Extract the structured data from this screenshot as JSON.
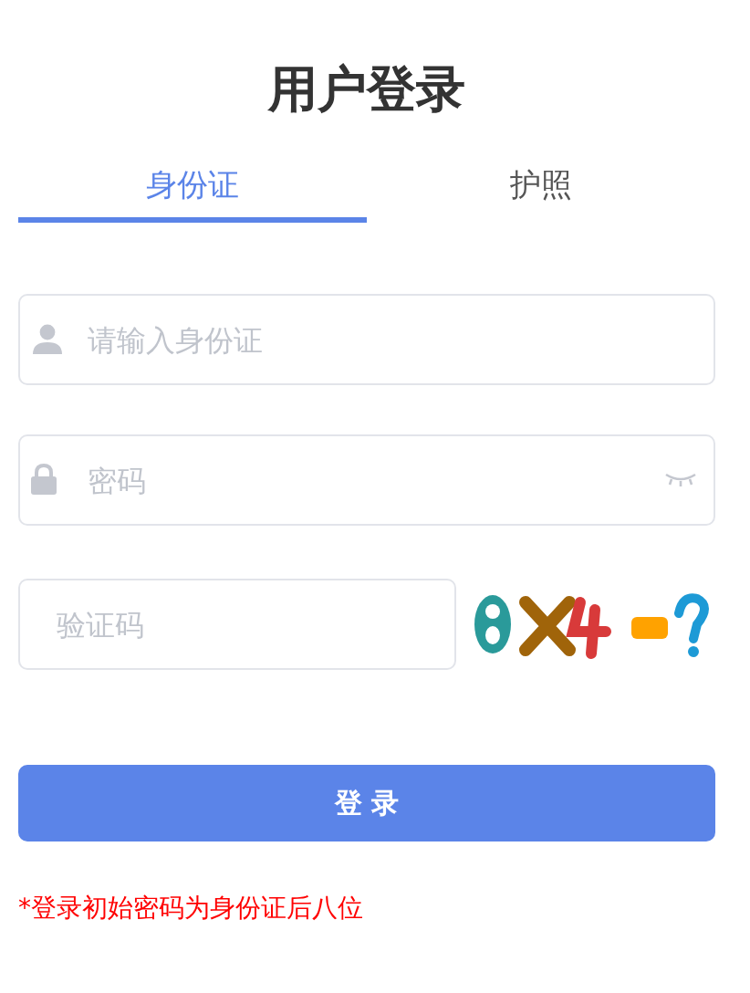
{
  "title": "用户登录",
  "tabs": [
    {
      "label": "身份证",
      "selected": true
    },
    {
      "label": "护照",
      "selected": false
    }
  ],
  "fields": [
    {
      "kind": "user",
      "placeholder": "请输入身份证"
    },
    {
      "kind": "password",
      "placeholder": "密码"
    }
  ],
  "captcha": {
    "placeholder": "验证码"
  },
  "login_button": "登 录",
  "note": "*登录初始密码为身份证后八位"
}
